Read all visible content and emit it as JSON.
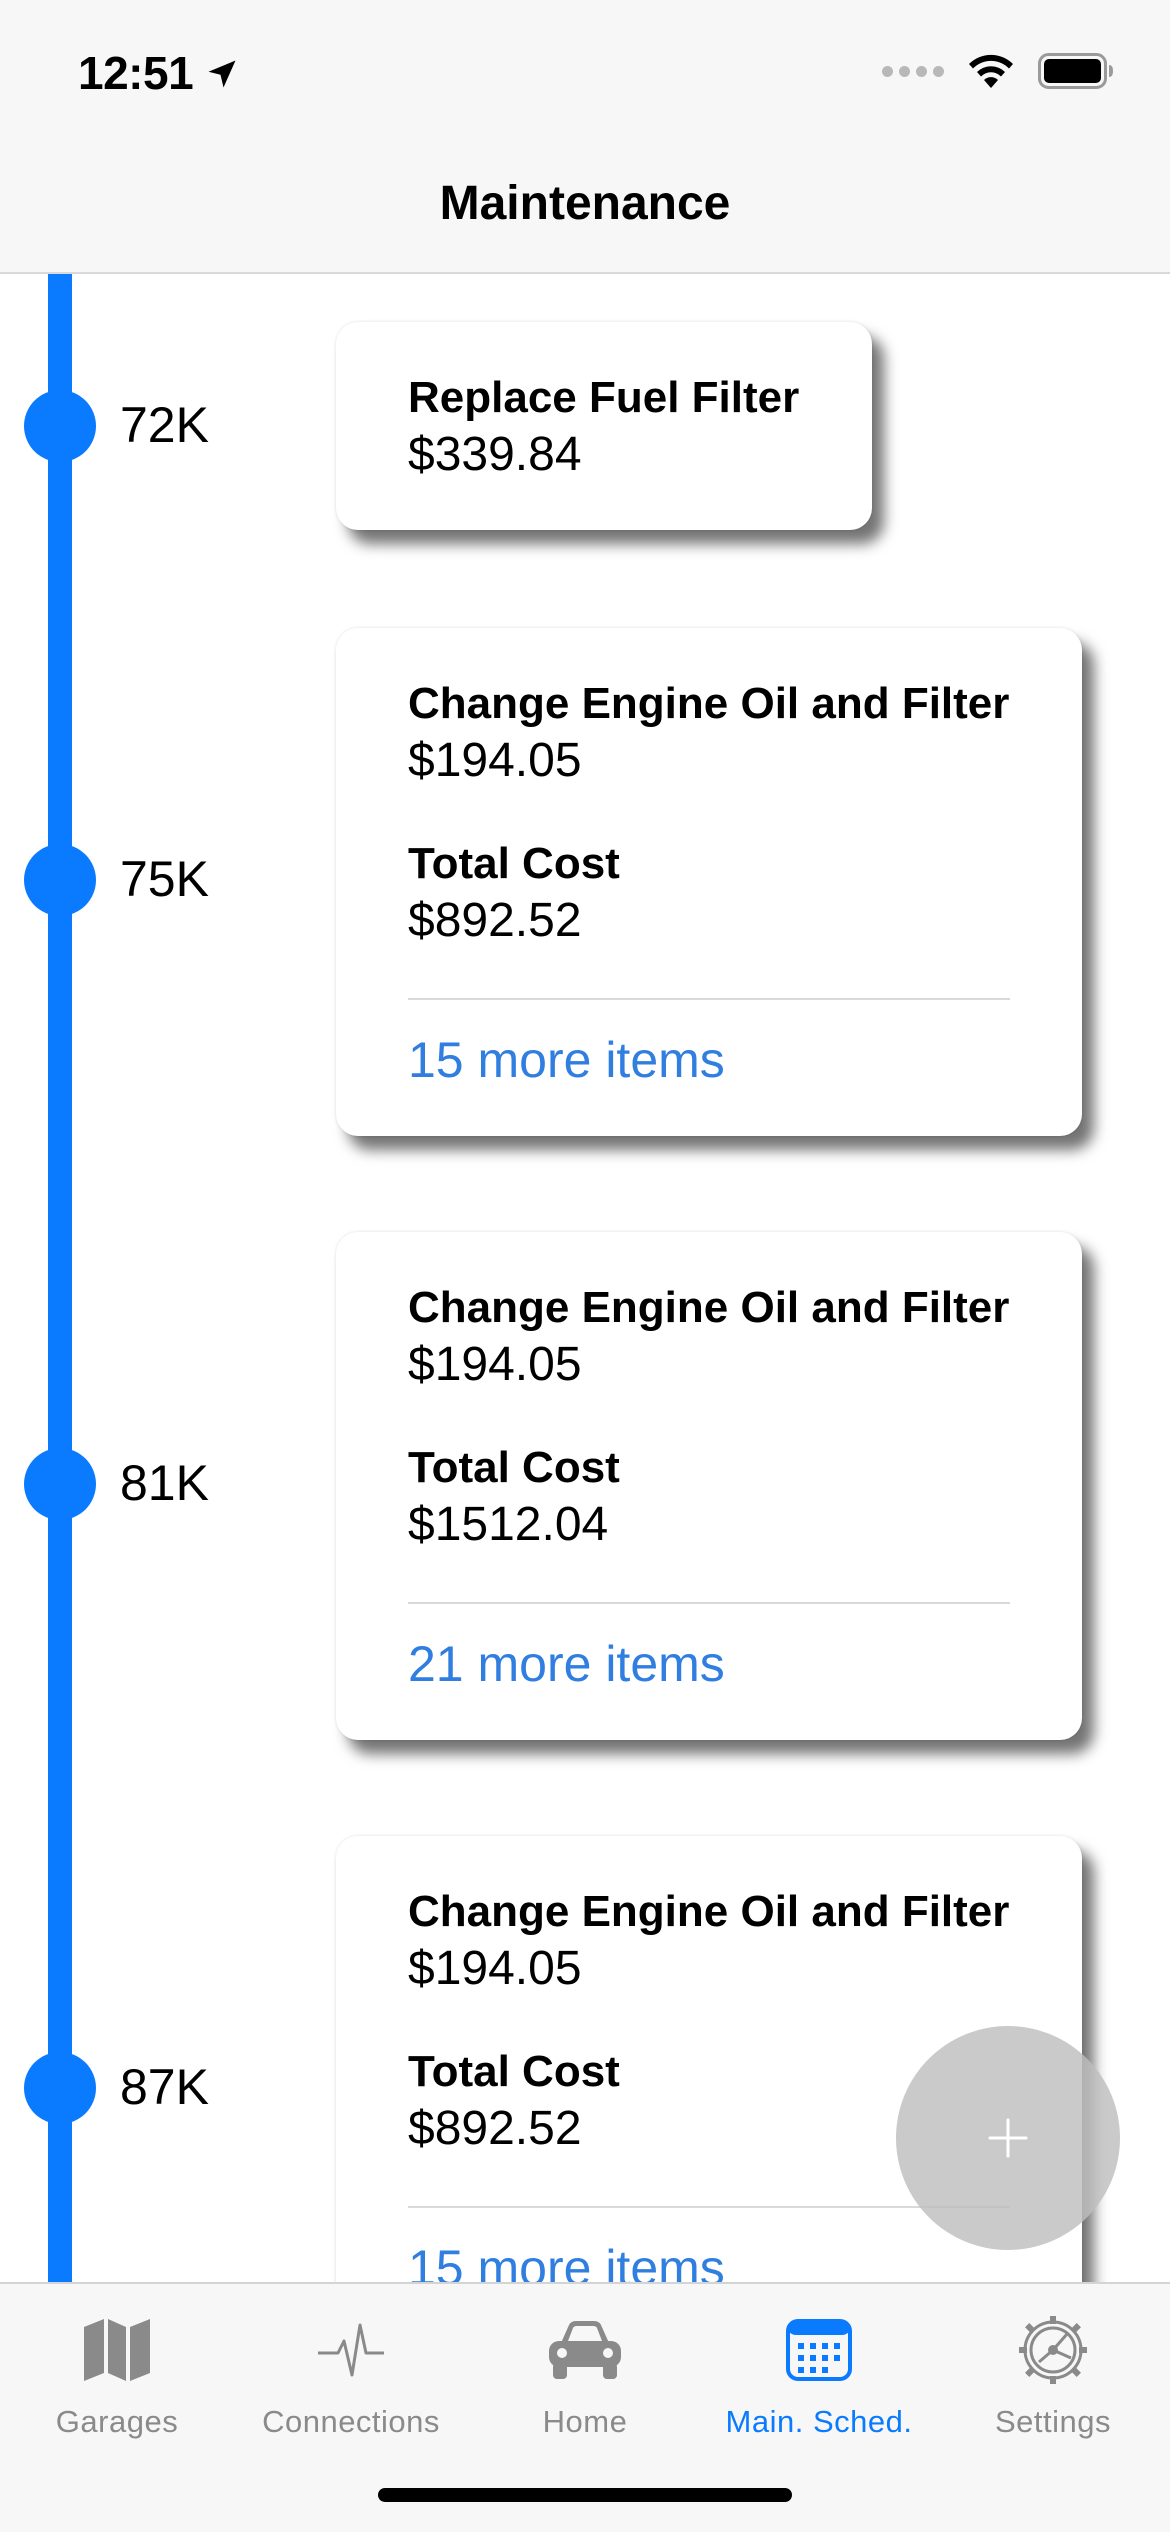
{
  "status_bar": {
    "time": "12:51"
  },
  "nav": {
    "title": "Maintenance"
  },
  "timeline": [
    {
      "mileage": "72K",
      "item": "Replace Fuel Filter",
      "price": "$339.84"
    },
    {
      "mileage": "75K",
      "item": "Change Engine Oil and Filter",
      "price": "$194.05",
      "total_label": "Total Cost",
      "total": "$892.52",
      "more": "15 more items"
    },
    {
      "mileage": "81K",
      "item": "Change Engine Oil and Filter",
      "price": "$194.05",
      "total_label": "Total Cost",
      "total": "$1512.04",
      "more": "21 more items"
    },
    {
      "mileage": "87K",
      "item": "Change Engine Oil and Filter",
      "price": "$194.05",
      "total_label": "Total Cost",
      "total": "$892.52",
      "more": "15 more items"
    }
  ],
  "fab": {
    "icon": "plus-icon"
  },
  "tabs": [
    {
      "label": "Garages",
      "icon": "map-icon",
      "active": false
    },
    {
      "label": "Connections",
      "icon": "pulse-icon",
      "active": false
    },
    {
      "label": "Home",
      "icon": "car-icon",
      "active": false
    },
    {
      "label": "Main. Sched.",
      "icon": "calendar-icon",
      "active": true
    },
    {
      "label": "Settings",
      "icon": "gear-icon",
      "active": false
    }
  ],
  "colors": {
    "accent": "#0a7bff",
    "link": "#2f7ee0",
    "inactive": "#8a8a8a"
  }
}
